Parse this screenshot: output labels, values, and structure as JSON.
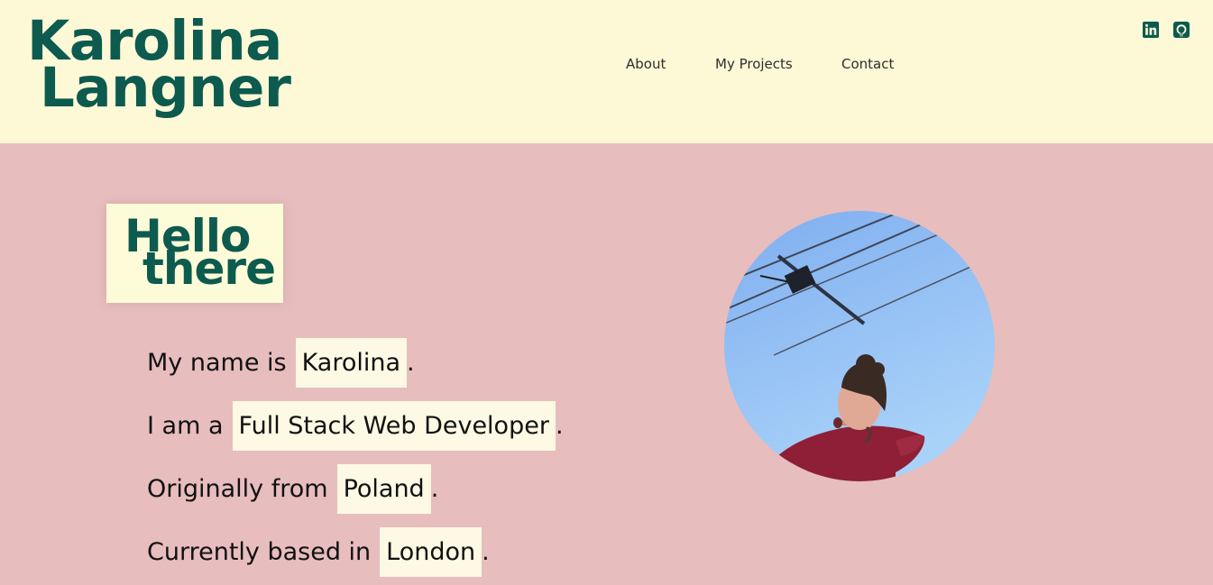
{
  "header": {
    "logo_line1": "Karolina",
    "logo_line2": "Langner",
    "nav": [
      {
        "label": "About"
      },
      {
        "label": "My Projects"
      },
      {
        "label": "Contact"
      }
    ],
    "social": [
      {
        "icon": "linkedin-icon"
      },
      {
        "icon": "github-icon"
      }
    ]
  },
  "hero": {
    "greeting_line1": "Hello",
    "greeting_line2": "there",
    "intro": [
      {
        "prefix": "My name is",
        "highlight": "Karolina",
        "suffix": "."
      },
      {
        "prefix": "I am a",
        "highlight": "Full Stack Web Developer",
        "suffix": "."
      },
      {
        "prefix": "Originally from",
        "highlight": "Poland",
        "suffix": "."
      },
      {
        "prefix": "Currently based in",
        "highlight": "London",
        "suffix": "."
      }
    ]
  },
  "colors": {
    "header_bg": "#fdf9d6",
    "main_bg": "#e8bdbd",
    "brand_green": "#0d5a4f",
    "highlight_bg": "#fdf9e4"
  }
}
